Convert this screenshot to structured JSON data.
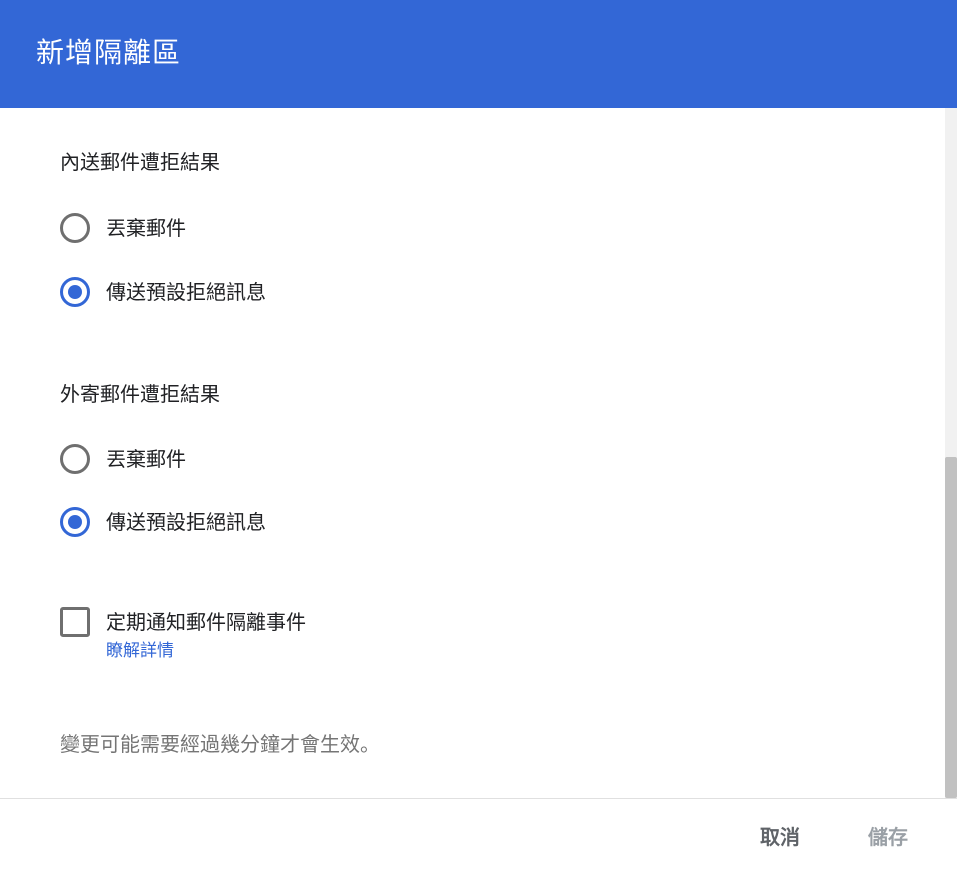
{
  "dialog": {
    "title": "新增隔離區"
  },
  "inbound": {
    "heading": "內送郵件遭拒結果",
    "options": [
      {
        "label": "丟棄郵件",
        "selected": false
      },
      {
        "label": "傳送預設拒絕訊息",
        "selected": true
      }
    ]
  },
  "outbound": {
    "heading": "外寄郵件遭拒結果",
    "options": [
      {
        "label": "丟棄郵件",
        "selected": false
      },
      {
        "label": "傳送預設拒絕訊息",
        "selected": true
      }
    ]
  },
  "notify": {
    "label": "定期通知郵件隔離事件",
    "checked": false,
    "learn_more": "瞭解詳情"
  },
  "note": "變更可能需要經過幾分鐘才會生效。",
  "footer": {
    "cancel_label": "取消",
    "save_label": "儲存"
  },
  "colors": {
    "header_bg": "#3367d6",
    "accent": "#3367d6"
  }
}
